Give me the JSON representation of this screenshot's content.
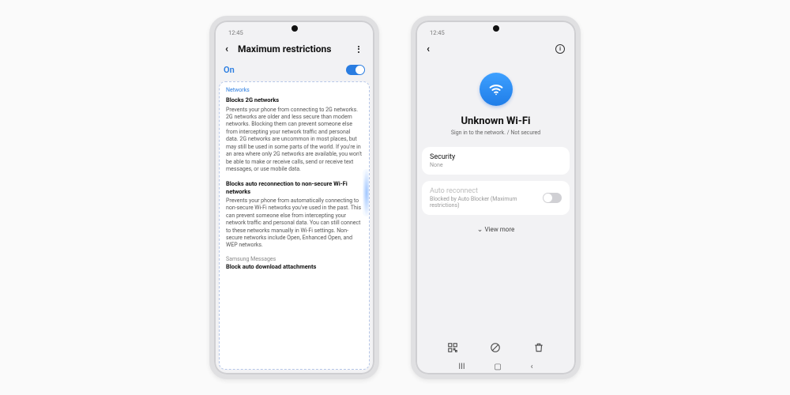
{
  "phone1": {
    "time": "12:45",
    "header_title": "Maximum restrictions",
    "toggle_label": "On",
    "toggle_on": true,
    "section1_label": "Networks",
    "block1": {
      "title": "Blocks 2G networks",
      "body": "Prevents your phone from connecting to 2G networks. 2G networks are older and less secure than modern networks. Blocking them can prevent someone else from intercepting your network traffic and personal data. 2G networks are uncommon in most places, but may still be used in some parts of the world. If you're in an area where only 2G networks are available, you won't be able to make or receive calls, send or receive text messages, or use mobile data."
    },
    "block2": {
      "title": "Blocks auto reconnection to non-secure Wi-Fi networks",
      "body": "Prevents your phone from automatically connecting to non-secure Wi-Fi networks you've used in the past. This can prevent someone else from intercepting your network traffic and personal data. You can still connect to these networks manually in Wi-Fi settings. Non-secure networks include Open, Enhanced Open, and WEP networks."
    },
    "section2_label": "Samsung Messages",
    "cut_row": "Block auto download attachments"
  },
  "phone2": {
    "time": "12:45",
    "wifi_name": "Unknown Wi-Fi",
    "wifi_sub": "Sign in to the network. / Not secured",
    "security": {
      "label": "Security",
      "value": "None"
    },
    "auto": {
      "label": "Auto reconnect",
      "value": "Blocked by Auto Blocker (Maximum restrictions)",
      "enabled": false
    },
    "view_more": "View more"
  }
}
